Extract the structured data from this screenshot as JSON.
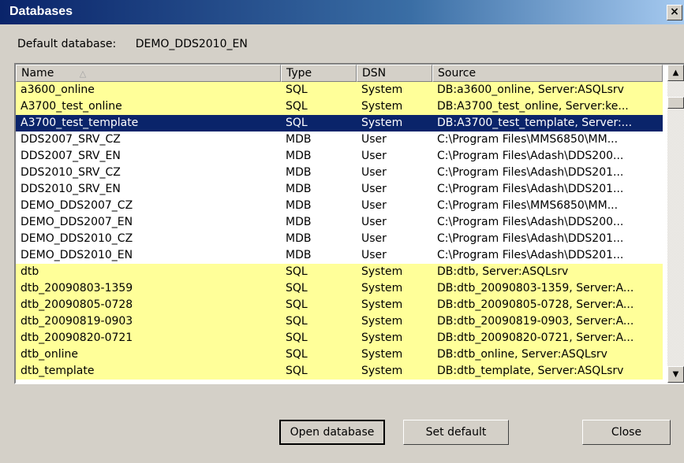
{
  "window": {
    "title": "Databases",
    "close_glyph": "×"
  },
  "default_database": {
    "label": "Default database:",
    "value": "DEMO_DDS2010_EN"
  },
  "columns": [
    "Name",
    "Type",
    "DSN",
    "Source"
  ],
  "sort_indicator": "△",
  "rows": [
    {
      "name": "a3600_online",
      "type": "SQL",
      "dsn": "System",
      "source": "DB:a3600_online, Server:ASQLsrv",
      "kind": "sql"
    },
    {
      "name": "A3700_test_online",
      "type": "SQL",
      "dsn": "System",
      "source": "DB:A3700_test_online, Server:ke...",
      "kind": "sql"
    },
    {
      "name": "A3700_test_template",
      "type": "SQL",
      "dsn": "System",
      "source": "DB:A3700_test_template, Server:...",
      "kind": "selected"
    },
    {
      "name": "DDS2007_SRV_CZ",
      "type": "MDB",
      "dsn": "User",
      "source": "C:\\Program Files\\MMS6850\\MM...",
      "kind": "mdb"
    },
    {
      "name": "DDS2007_SRV_EN",
      "type": "MDB",
      "dsn": "User",
      "source": "C:\\Program Files\\Adash\\DDS200...",
      "kind": "mdb"
    },
    {
      "name": "DDS2010_SRV_CZ",
      "type": "MDB",
      "dsn": "User",
      "source": "C:\\Program Files\\Adash\\DDS201...",
      "kind": "mdb"
    },
    {
      "name": "DDS2010_SRV_EN",
      "type": "MDB",
      "dsn": "User",
      "source": "C:\\Program Files\\Adash\\DDS201...",
      "kind": "mdb"
    },
    {
      "name": "DEMO_DDS2007_CZ",
      "type": "MDB",
      "dsn": "User",
      "source": "C:\\Program Files\\MMS6850\\MM...",
      "kind": "mdb"
    },
    {
      "name": "DEMO_DDS2007_EN",
      "type": "MDB",
      "dsn": "User",
      "source": "C:\\Program Files\\Adash\\DDS200...",
      "kind": "mdb"
    },
    {
      "name": "DEMO_DDS2010_CZ",
      "type": "MDB",
      "dsn": "User",
      "source": "C:\\Program Files\\Adash\\DDS201...",
      "kind": "mdb"
    },
    {
      "name": "DEMO_DDS2010_EN",
      "type": "MDB",
      "dsn": "User",
      "source": "C:\\Program Files\\Adash\\DDS201...",
      "kind": "mdb"
    },
    {
      "name": "dtb",
      "type": "SQL",
      "dsn": "System",
      "source": "DB:dtb, Server:ASQLsrv",
      "kind": "sql"
    },
    {
      "name": "dtb_20090803-1359",
      "type": "SQL",
      "dsn": "System",
      "source": "DB:dtb_20090803-1359, Server:A...",
      "kind": "sql"
    },
    {
      "name": "dtb_20090805-0728",
      "type": "SQL",
      "dsn": "System",
      "source": "DB:dtb_20090805-0728, Server:A...",
      "kind": "sql"
    },
    {
      "name": "dtb_20090819-0903",
      "type": "SQL",
      "dsn": "System",
      "source": "DB:dtb_20090819-0903, Server:A...",
      "kind": "sql"
    },
    {
      "name": "dtb_20090820-0721",
      "type": "SQL",
      "dsn": "System",
      "source": "DB:dtb_20090820-0721, Server:A...",
      "kind": "sql"
    },
    {
      "name": "dtb_online",
      "type": "SQL",
      "dsn": "System",
      "source": "DB:dtb_online, Server:ASQLsrv",
      "kind": "sql"
    },
    {
      "name": "dtb_template",
      "type": "SQL",
      "dsn": "System",
      "source": "DB:dtb_template, Server:ASQLsrv",
      "kind": "sql"
    }
  ],
  "scrollbar": {
    "up_glyph": "▲",
    "down_glyph": "▼"
  },
  "buttons": {
    "open": "Open database",
    "set_default": "Set default",
    "close": "Close"
  },
  "colors": {
    "sql_row": "#ffff99",
    "selected_row": "#0a246a",
    "selected_text": "#ffffff"
  }
}
